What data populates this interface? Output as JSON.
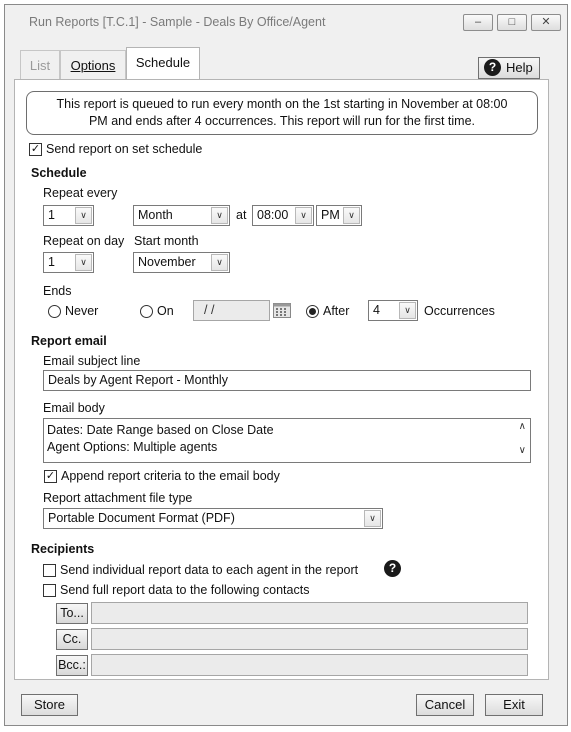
{
  "window": {
    "title": "Run Reports [T.C.1] - Sample - Deals By Office/Agent",
    "controls": {
      "minimize": "–",
      "restore": "□",
      "close": "✕"
    }
  },
  "tabs": [
    {
      "label": "List",
      "active": false,
      "disabled": true
    },
    {
      "label": "Options",
      "active": false,
      "disabled": false
    },
    {
      "label": "Schedule",
      "active": true,
      "disabled": false
    }
  ],
  "help": {
    "label": "Help",
    "icon": "question-circle-icon"
  },
  "notice": {
    "line1": "This report is queued to run every month on the 1st starting in November at 08:00",
    "line2": "PM and ends after 4 occurrences. This report will run for the first time."
  },
  "send_on_schedule": {
    "label": "Send report on set schedule",
    "checked": true
  },
  "schedule": {
    "heading": "Schedule",
    "repeat_every_label": "Repeat every",
    "repeat_every_value": "1",
    "repeat_unit": "Month",
    "at_label": "at",
    "time_value": "08:00",
    "ampm_value": "PM",
    "repeat_on_day_label": "Repeat on day",
    "repeat_on_day_value": "1",
    "start_month_label": "Start month",
    "start_month_value": "November",
    "ends_label": "Ends",
    "never_label": "Never",
    "on_label": "On",
    "on_date_value": "/ /",
    "after_label": "After",
    "after_value": "4",
    "occurrences_label": "Occurrences",
    "ends_selected": "after"
  },
  "report_email": {
    "heading": "Report email",
    "subject_label": "Email subject line",
    "subject_value": "Deals by Agent Report - Monthly",
    "body_label": "Email body",
    "body_lines": [
      "Dates: Date Range based on Close Date",
      "Agent Options: Multiple agents"
    ],
    "append_label": "Append report criteria to the email body",
    "append_checked": true,
    "attachment_label": "Report attachment file type",
    "attachment_value": "Portable Document Format (PDF)"
  },
  "recipients": {
    "heading": "Recipients",
    "individual_label": "Send individual report data to each agent in the report",
    "individual_checked": false,
    "full_label": "Send full report data to the following contacts",
    "full_checked": false,
    "to_label": "To...",
    "cc_label": "Cc.",
    "bcc_label": "Bcc.:",
    "to_value": "",
    "cc_value": "",
    "bcc_value": ""
  },
  "footer": {
    "store_label": "Store",
    "cancel_label": "Cancel",
    "exit_label": "Exit"
  }
}
